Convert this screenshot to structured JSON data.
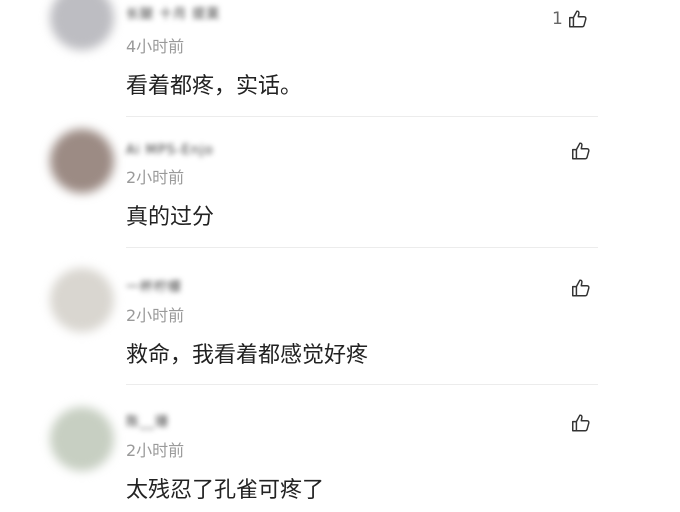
{
  "comments": [
    {
      "username": "长腿 十月 提莫",
      "time": "4小时前",
      "text": "看着都疼，实话。",
      "likes": "1",
      "avatar_color": "#bdbdc2"
    },
    {
      "username": "Ai MPS-Enjo",
      "time": "2小时前",
      "text": "真的过分",
      "likes": "",
      "avatar_color": "#9c8b84"
    },
    {
      "username": "一杯柠檬",
      "time": "2小时前",
      "text": "救命，我看着都感觉好疼",
      "likes": "",
      "avatar_color": "#d9d6d0"
    },
    {
      "username": "陈__珊",
      "time": "2小时前",
      "text": "太残忍了孔雀可疼了",
      "likes": "",
      "avatar_color": "#c7cfc2"
    }
  ],
  "icons": {
    "like": "thumbs-up-outline-icon"
  }
}
